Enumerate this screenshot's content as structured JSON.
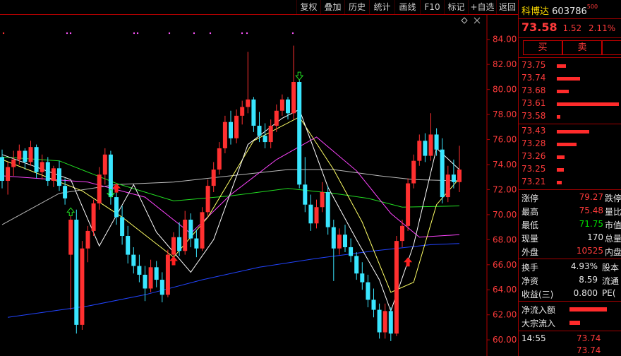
{
  "toolbar": {
    "items": [
      "复权",
      "叠加",
      "历史",
      "统计",
      "画线",
      "F10",
      "标记",
      "+自选",
      "返回"
    ]
  },
  "chart_data": {
    "type": "candlestick",
    "ylim": [
      59.5,
      85
    ],
    "y_ticks": [
      "84.00",
      "82.00",
      "80.00",
      "78.00",
      "76.00",
      "74.00",
      "72.00",
      "70.00",
      "68.00",
      "66.00",
      "64.00",
      "62.00",
      "60.00"
    ],
    "colors": {
      "up": "#ff3030",
      "down": "#39e6ff",
      "ma5": "#ffffff",
      "ma10": "#ffff66",
      "ma20": "#ff44ff",
      "ma60": "#22dd22",
      "ma120": "#bbbbbb",
      "ma250": "#2244ff"
    },
    "candles": [
      [
        74.6,
        75.2,
        72.1,
        72.7
      ],
      [
        72.7,
        74.2,
        71.6,
        73.8
      ],
      [
        73.8,
        75.1,
        73.1,
        74.4
      ],
      [
        74.4,
        75.6,
        74.0,
        75.1
      ],
      [
        75.1,
        75.3,
        73.6,
        74.2
      ],
      [
        74.2,
        75.9,
        73.9,
        75.4
      ],
      [
        75.4,
        75.6,
        72.9,
        73.4
      ],
      [
        73.4,
        74.8,
        72.8,
        74.2
      ],
      [
        74.2,
        74.6,
        72.3,
        72.7
      ],
      [
        72.7,
        73.9,
        72.2,
        73.7
      ],
      [
        73.7,
        74.3,
        71.9,
        72.3
      ],
      [
        72.3,
        72.9,
        70.8,
        71.3
      ],
      [
        66.8,
        69.9,
        62.4,
        69.6
      ],
      [
        69.6,
        70.4,
        60.5,
        61.2
      ],
      [
        61.2,
        67.9,
        60.8,
        67.3
      ],
      [
        67.3,
        69.1,
        66.2,
        68.7
      ],
      [
        68.7,
        71.2,
        68.3,
        70.9
      ],
      [
        70.9,
        73.8,
        70.4,
        73.2
      ],
      [
        73.2,
        75.3,
        72.4,
        74.8
      ],
      [
        74.8,
        75.1,
        70.8,
        71.4
      ],
      [
        71.4,
        72.3,
        69.2,
        69.8
      ],
      [
        69.8,
        70.7,
        67.6,
        68.3
      ],
      [
        68.3,
        69.1,
        66.1,
        66.8
      ],
      [
        66.8,
        67.4,
        65.3,
        65.9
      ],
      [
        65.9,
        66.8,
        64.6,
        65.2
      ],
      [
        65.2,
        65.9,
        63.1,
        64.1
      ],
      [
        64.1,
        66.4,
        63.8,
        65.8
      ],
      [
        65.8,
        66.3,
        64.2,
        64.8
      ],
      [
        64.8,
        65.4,
        63.0,
        63.6
      ],
      [
        63.6,
        67.2,
        63.4,
        66.8
      ],
      [
        66.8,
        68.6,
        66.4,
        68.2
      ],
      [
        68.2,
        69.4,
        66.7,
        67.1
      ],
      [
        67.1,
        70.3,
        66.8,
        69.6
      ],
      [
        69.6,
        70.1,
        67.4,
        68.1
      ],
      [
        68.1,
        68.8,
        66.6,
        67.3
      ],
      [
        67.3,
        70.6,
        67.1,
        70.2
      ],
      [
        70.2,
        72.8,
        69.9,
        72.3
      ],
      [
        72.3,
        74.2,
        71.8,
        73.6
      ],
      [
        73.6,
        75.8,
        73.2,
        75.3
      ],
      [
        75.3,
        77.9,
        74.9,
        77.4
      ],
      [
        77.4,
        78.3,
        75.6,
        76.1
      ],
      [
        76.1,
        78.4,
        75.7,
        77.9
      ],
      [
        77.9,
        79.1,
        77.2,
        78.6
      ],
      [
        78.6,
        83.0,
        78.1,
        79.2
      ],
      [
        79.2,
        79.4,
        76.6,
        77.1
      ],
      [
        77.1,
        78.2,
        75.8,
        76.3
      ],
      [
        76.3,
        77.3,
        75.3,
        75.8
      ],
      [
        75.8,
        77.6,
        75.3,
        77.1
      ],
      [
        77.1,
        78.8,
        76.6,
        78.3
      ],
      [
        78.3,
        79.6,
        77.9,
        79.2
      ],
      [
        79.2,
        79.4,
        77.6,
        78.1
      ],
      [
        78.1,
        83.5,
        77.6,
        80.6
      ],
      [
        80.6,
        80.8,
        72.1,
        72.4
      ],
      [
        72.4,
        74.6,
        70.2,
        70.8
      ],
      [
        70.8,
        71.6,
        68.7,
        69.3
      ],
      [
        69.3,
        71.2,
        68.9,
        70.6
      ],
      [
        70.6,
        72.6,
        70.2,
        71.8
      ],
      [
        71.8,
        72.3,
        68.4,
        69.0
      ],
      [
        69.0,
        69.6,
        64.7,
        67.3
      ],
      [
        67.3,
        68.9,
        66.8,
        68.4
      ],
      [
        68.4,
        69.2,
        67.0,
        67.4
      ],
      [
        67.4,
        68.1,
        66.2,
        66.7
      ],
      [
        66.7,
        67.0,
        64.8,
        65.3
      ],
      [
        65.3,
        66.2,
        64.0,
        64.6
      ],
      [
        64.6,
        65.2,
        62.6,
        63.2
      ],
      [
        63.2,
        64.1,
        61.8,
        62.4
      ],
      [
        62.4,
        62.9,
        60.1,
        60.6
      ],
      [
        60.6,
        62.9,
        60.1,
        62.3
      ],
      [
        62.3,
        62.6,
        59.9,
        60.5
      ],
      [
        60.5,
        68.3,
        60.3,
        67.9
      ],
      [
        67.9,
        69.6,
        67.4,
        69.1
      ],
      [
        69.1,
        72.9,
        68.7,
        72.5
      ],
      [
        72.5,
        74.8,
        72.1,
        74.3
      ],
      [
        74.3,
        76.4,
        73.9,
        75.9
      ],
      [
        75.9,
        76.5,
        74.2,
        74.7
      ],
      [
        74.7,
        78.1,
        74.3,
        76.4
      ],
      [
        76.4,
        76.9,
        74.7,
        75.2
      ],
      [
        75.2,
        76.1,
        70.9,
        71.4
      ],
      [
        71.4,
        73.9,
        71.0,
        73.2
      ],
      [
        73.2,
        74.4,
        72.1,
        72.6
      ],
      [
        72.6,
        75.5,
        71.8,
        73.6
      ]
    ],
    "lines": {
      "ma5": [
        [
          0,
          74.8
        ],
        [
          12,
          72.8
        ],
        [
          17,
          67.5
        ],
        [
          23,
          72.4
        ],
        [
          27,
          68.6
        ],
        [
          33,
          65.4
        ],
        [
          37,
          68.0
        ],
        [
          43,
          75.6
        ],
        [
          49,
          77.7
        ],
        [
          52,
          78.4
        ],
        [
          57,
          72.2
        ],
        [
          62,
          68.0
        ],
        [
          66,
          64.8
        ],
        [
          68,
          62.3
        ],
        [
          72,
          67.6
        ],
        [
          76,
          75.3
        ],
        [
          80,
          73.6
        ]
      ],
      "ma10": [
        [
          0,
          74.4
        ],
        [
          14,
          71.9
        ],
        [
          21,
          69.8
        ],
        [
          30,
          66.6
        ],
        [
          36,
          69.8
        ],
        [
          44,
          75.9
        ],
        [
          52,
          77.8
        ],
        [
          58,
          73.6
        ],
        [
          63,
          69.4
        ],
        [
          68,
          63.8
        ],
        [
          72,
          64.6
        ],
        [
          76,
          70.8
        ],
        [
          80,
          72.9
        ]
      ],
      "ma20": [
        [
          0,
          73.1
        ],
        [
          15,
          72.6
        ],
        [
          25,
          71.4
        ],
        [
          33,
          68.5
        ],
        [
          40,
          71.6
        ],
        [
          48,
          74.4
        ],
        [
          55,
          76.2
        ],
        [
          62,
          73.5
        ],
        [
          68,
          70.1
        ],
        [
          73,
          68.2
        ],
        [
          80,
          68.4
        ]
      ],
      "ma60": [
        [
          0,
          74.6
        ],
        [
          10,
          74.3
        ],
        [
          20,
          72.5
        ],
        [
          30,
          71.1
        ],
        [
          40,
          71.5
        ],
        [
          50,
          72.1
        ],
        [
          58,
          71.7
        ],
        [
          64,
          71.3
        ],
        [
          70,
          70.6
        ],
        [
          80,
          70.7
        ]
      ],
      "ma120": [
        [
          0,
          69.2
        ],
        [
          10,
          71.7
        ],
        [
          20,
          72.4
        ],
        [
          30,
          72.6
        ],
        [
          40,
          73.1
        ],
        [
          50,
          73.6
        ],
        [
          58,
          73.6
        ],
        [
          66,
          73.1
        ],
        [
          72,
          72.8
        ],
        [
          80,
          72.7
        ]
      ],
      "ma250": [
        [
          1,
          61.8
        ],
        [
          15,
          62.7
        ],
        [
          25,
          63.6
        ],
        [
          35,
          64.8
        ],
        [
          45,
          65.8
        ],
        [
          55,
          66.5
        ],
        [
          65,
          67.1
        ],
        [
          75,
          67.6
        ],
        [
          80,
          67.7
        ]
      ]
    },
    "markers": [
      {
        "index": 12,
        "price": 70.2,
        "type": "buy-signal-up"
      },
      {
        "index": 19,
        "price": 71.7,
        "type": "sell-signal-down"
      },
      {
        "index": 20,
        "price": 72.1,
        "type": "buy-arrow-up"
      },
      {
        "index": 30,
        "price": 66.3,
        "type": "buy-arrow-up"
      },
      {
        "index": 52,
        "price": 81.1,
        "type": "sell-signal-down"
      },
      {
        "index": 71,
        "price": 66.2,
        "type": "buy-arrow-up"
      }
    ]
  },
  "panel": {
    "stock_name": "科博达",
    "stock_code": "603786",
    "code_badge": "500",
    "price": "73.58",
    "change": "1.52",
    "change_pct": "2.11%",
    "buy_label": "买",
    "sell_label": "卖",
    "ask_prices": [
      "73.75",
      "73.74",
      "73.68",
      "73.61",
      "73.58"
    ],
    "ask_bar_fracs": [
      0.14,
      0.37,
      0.19,
      0.98,
      0.05
    ],
    "bid_prices": [
      "73.43",
      "73.28",
      "73.26",
      "73.25",
      "73.21"
    ],
    "bid_bar_fracs": [
      0.51,
      0.31,
      0.12,
      0.11,
      0.08
    ],
    "stats": [
      {
        "label": "涨停",
        "value": "79.27",
        "label2": "跌停",
        "color": "red"
      },
      {
        "label": "最高",
        "value": "75.48",
        "label2": "量比",
        "color": "red"
      },
      {
        "label": "最低",
        "value": "71.75",
        "label2": "市值",
        "color": "green"
      },
      {
        "label": "现量",
        "value": "170",
        "label2": "总量",
        "color": "white"
      },
      {
        "label": "外盘",
        "value": "10525",
        "label2": "内盘",
        "color": "red"
      }
    ],
    "stats2": [
      {
        "label": "换手",
        "value": "4.93%",
        "label2": "股本"
      },
      {
        "label": "净资",
        "value": "8.59",
        "label2": "流通"
      },
      {
        "label": "收益(三)",
        "value": "0.800",
        "label2": "PE("
      }
    ],
    "flow": [
      {
        "label": "净流入额",
        "frac": 0.92
      },
      {
        "label": "大宗流入",
        "frac": 0.26
      }
    ],
    "ticks": [
      {
        "time": "14:55",
        "price": "73.74"
      },
      {
        "time": "",
        "price": "73.74"
      }
    ]
  }
}
